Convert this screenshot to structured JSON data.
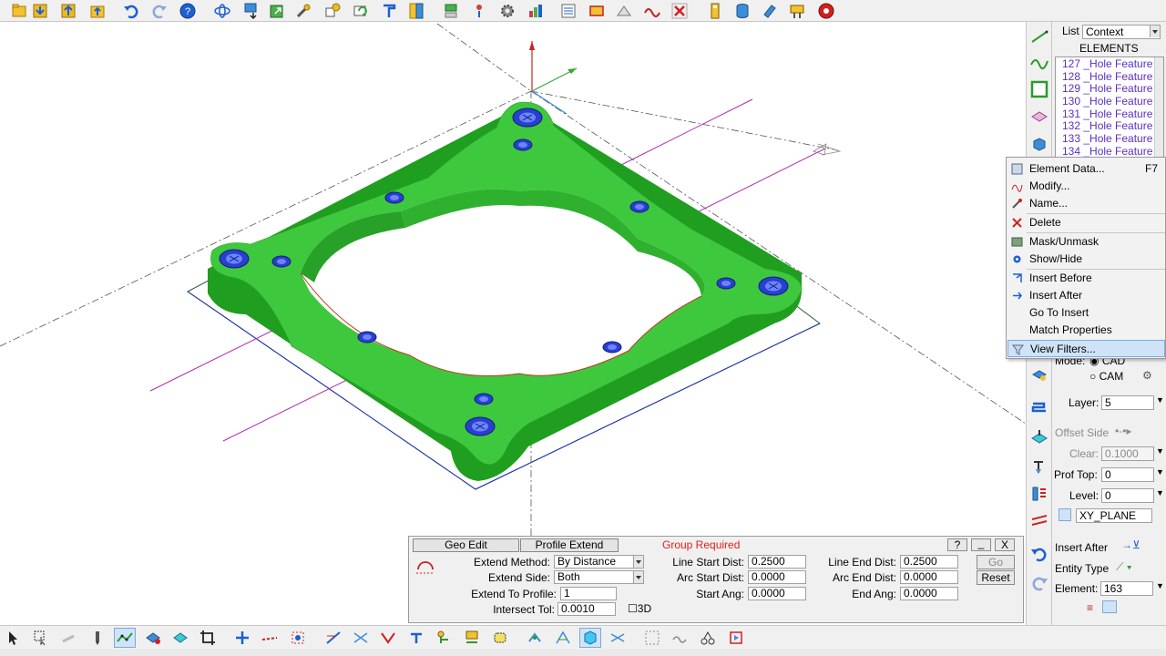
{
  "toolbar_top": {
    "icons": [
      "open-file-icon",
      "save-icon",
      "up-arrow-icon",
      "up-folder-icon",
      "undo-icon",
      "redo-icon",
      "help-icon",
      "orbit-icon",
      "import-icon",
      "export-icon",
      "tool-icon",
      "transform-icon",
      "rotate-icon",
      "book-icon",
      "layer-icon",
      "flag-icon",
      "settings-icon",
      "chart-icon",
      "list-icon",
      "table-icon",
      "grid-icon",
      "wave-icon",
      "delete-icon",
      "calculator-icon",
      "database-icon",
      "refresh-icon",
      "machine-icon",
      "stop-icon"
    ]
  },
  "right_panel": {
    "list_label": "List",
    "list_value": "Context",
    "elements_header": "ELEMENTS",
    "elements": [
      "127 _Hole Feature",
      "128 _Hole Feature",
      "129 _Hole Feature",
      "130 _Hole Feature",
      "131 _Hole Feature",
      "132 _Hole Feature",
      "133 _Hole Feature",
      "134 _Hole Feature"
    ],
    "mode_label": "Mode:",
    "mode_cad": "CAD",
    "mode_cam": "CAM",
    "layer_label": "Layer:",
    "layer_value": "5",
    "offset_side_label": "Offset Side",
    "clear_label": "Clear:",
    "clear_value": "0.1000",
    "prof_top_label": "Prof Top:",
    "prof_top_value": "0",
    "level_label": "Level:",
    "level_value": "0",
    "plane_value": "XY_PLANE",
    "insert_after_label": "Insert After",
    "entity_type_label": "Entity Type",
    "element_label": "Element:",
    "element_value": "163"
  },
  "context_menu": {
    "items": [
      {
        "label": "Element Data...",
        "shortcut": "F7"
      },
      {
        "label": "Modify...",
        "shortcut": ""
      },
      {
        "label": "Name...",
        "shortcut": ""
      },
      {
        "label": "Delete",
        "shortcut": ""
      },
      {
        "label": "Mask/Unmask",
        "shortcut": ""
      },
      {
        "label": "Show/Hide",
        "shortcut": ""
      },
      {
        "label": "Insert Before",
        "shortcut": ""
      },
      {
        "label": "Insert After",
        "shortcut": ""
      },
      {
        "label": "Go To Insert",
        "shortcut": ""
      },
      {
        "label": "Match Properties",
        "shortcut": ""
      },
      {
        "label": "View Filters...",
        "shortcut": ""
      }
    ]
  },
  "dialog": {
    "tab_geo_edit": "Geo Edit",
    "tab_profile_extend": "Profile Extend",
    "status": "Group Required",
    "help_btn": "?",
    "min_btn": "_",
    "close_btn": "X",
    "extend_method_label": "Extend Method:",
    "extend_method_value": "By Distance",
    "extend_side_label": "Extend Side:",
    "extend_side_value": "Both",
    "extend_to_profile_label": "Extend To Profile:",
    "extend_to_profile_value": "1",
    "intersect_tol_label": "Intersect Tol:",
    "intersect_tol_value": "0.0010",
    "threed_label": "3D",
    "line_start_label": "Line Start Dist:",
    "line_start_value": "0.2500",
    "arc_start_label": "Arc Start Dist:",
    "arc_start_value": "0.0000",
    "start_ang_label": "Start Ang:",
    "start_ang_value": "0.0000",
    "line_end_label": "Line End Dist:",
    "line_end_value": "0.2500",
    "arc_end_label": "Arc End Dist:",
    "arc_end_value": "0.0000",
    "end_ang_label": "End Ang:",
    "end_ang_value": "0.0000",
    "go_btn": "Go",
    "reset_btn": "Reset"
  },
  "colors": {
    "part_green": "#3ec83e",
    "part_dark": "#1f8f1f",
    "hole_blue": "#2a3fcf",
    "profile_magenta": "#b02cb0",
    "list_text": "#5a2fc2",
    "status_red": "#e0201c"
  }
}
